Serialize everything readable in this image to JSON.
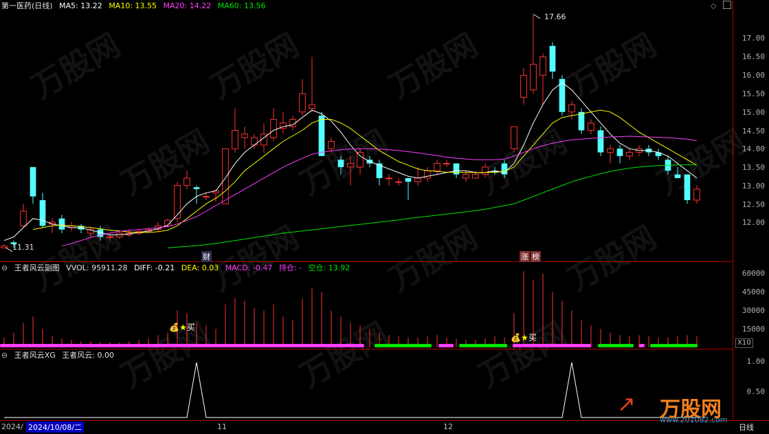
{
  "colors": {
    "up": "#ff3232",
    "down": "#54ffff",
    "ma5": "#ffffff",
    "ma10": "#ffff00",
    "ma20": "#ff3cff",
    "ma60": "#00e600",
    "grid": "#b00000",
    "text": "#c0c0c0"
  },
  "main": {
    "title": "第一医药(日线)",
    "ma5": "MA5: 13.22",
    "ma10": "MA10: 13.55",
    "ma20": "MA20: 14.22",
    "ma60": "MA60: 13.56",
    "high_label": "17.66",
    "low_label": "11.31",
    "axis": [
      "17.00",
      "16.50",
      "16.00",
      "15.50",
      "15.00",
      "14.50",
      "14.00",
      "13.50",
      "13.00",
      "12.50",
      "12.00"
    ],
    "tags": {
      "cai": "财",
      "zhangting": "涨",
      "bang": "榜"
    },
    "corner_icons": [
      "diamond-icon",
      "square-icon"
    ]
  },
  "sub1": {
    "name": "王者风云副图",
    "vol": "VVOL: 95911.28",
    "diff": "DIFF: -0.21",
    "dea": "DEA: 0.03",
    "macd": "MACD: -0.47",
    "hold": "持仓: -",
    "empty": "空仓: 13.92",
    "axis": [
      "60000",
      "45000",
      "30000",
      "15000"
    ],
    "scale": "X10",
    "buy1": "买",
    "buy2": "买",
    "segments": [
      {
        "state": "hold",
        "start": 0,
        "end": 530
      },
      {
        "state": "empty",
        "start": 545,
        "end": 628
      },
      {
        "state": "hold",
        "start": 638,
        "end": 660
      },
      {
        "state": "empty",
        "start": 668,
        "end": 738
      },
      {
        "state": "hold",
        "start": 746,
        "end": 860
      },
      {
        "state": "empty",
        "start": 870,
        "end": 922
      },
      {
        "state": "hold",
        "start": 930,
        "end": 938
      },
      {
        "state": "empty",
        "start": 946,
        "end": 1015
      }
    ]
  },
  "sub2": {
    "name": "王者风云XG",
    "val": "王者风云: 0.00",
    "axis": [
      "1.00",
      "0.50"
    ]
  },
  "xaxis": {
    "left": "2024/",
    "cursor": "2024/10/08/二",
    "m11": "11",
    "m12": "12",
    "period": "日线"
  },
  "watermark": {
    "brand": "万股网",
    "url": "www.201082.com"
  },
  "chart_data": {
    "type": "candlestick",
    "title": "第一医药(日线)",
    "price_range": [
      11.0,
      17.6
    ],
    "candles": [
      {
        "o": 11.3,
        "c": 11.35,
        "h": 11.4,
        "l": 11.31
      },
      {
        "o": 11.45,
        "c": 11.4,
        "h": 11.5,
        "l": 11.3
      },
      {
        "o": 11.9,
        "c": 12.3,
        "h": 12.5,
        "l": 11.85
      },
      {
        "o": 13.5,
        "c": 12.7,
        "h": 13.5,
        "l": 12.5
      },
      {
        "o": 12.6,
        "c": 11.9,
        "h": 12.8,
        "l": 11.85
      },
      {
        "o": 11.95,
        "c": 12.0,
        "h": 12.1,
        "l": 11.7
      },
      {
        "o": 12.1,
        "c": 11.8,
        "h": 12.2,
        "l": 11.7
      },
      {
        "o": 11.85,
        "c": 11.9,
        "h": 12.0,
        "l": 11.75
      },
      {
        "o": 11.9,
        "c": 11.8,
        "h": 11.95,
        "l": 11.7
      },
      {
        "o": 11.7,
        "c": 11.8,
        "h": 11.9,
        "l": 11.6
      },
      {
        "o": 11.8,
        "c": 11.6,
        "h": 11.9,
        "l": 11.5
      },
      {
        "o": 11.6,
        "c": 11.6,
        "h": 11.7,
        "l": 11.5
      },
      {
        "o": 11.6,
        "c": 11.7,
        "h": 11.75,
        "l": 11.55
      },
      {
        "o": 11.65,
        "c": 11.7,
        "h": 11.8,
        "l": 11.6
      },
      {
        "o": 11.7,
        "c": 11.75,
        "h": 11.8,
        "l": 11.65
      },
      {
        "o": 11.75,
        "c": 11.8,
        "h": 11.85,
        "l": 11.7
      },
      {
        "o": 11.8,
        "c": 11.9,
        "h": 12.0,
        "l": 11.75
      },
      {
        "o": 11.9,
        "c": 12.05,
        "h": 12.1,
        "l": 11.85
      },
      {
        "o": 12.1,
        "c": 13.0,
        "h": 13.1,
        "l": 12.0
      },
      {
        "o": 13.0,
        "c": 13.2,
        "h": 13.4,
        "l": 12.9
      },
      {
        "o": 12.95,
        "c": 12.9,
        "h": 13.0,
        "l": 12.5
      },
      {
        "o": 12.7,
        "c": 12.7,
        "h": 12.8,
        "l": 12.6
      },
      {
        "o": 12.8,
        "c": 12.85,
        "h": 12.9,
        "l": 12.55
      },
      {
        "o": 12.5,
        "c": 14.0,
        "h": 14.0,
        "l": 12.5
      },
      {
        "o": 14.0,
        "c": 14.5,
        "h": 15.1,
        "l": 13.9
      },
      {
        "o": 14.3,
        "c": 14.4,
        "h": 14.6,
        "l": 14.0
      },
      {
        "o": 14.1,
        "c": 14.3,
        "h": 14.4,
        "l": 14.0
      },
      {
        "o": 14.1,
        "c": 14.4,
        "h": 14.7,
        "l": 13.9
      },
      {
        "o": 14.3,
        "c": 14.8,
        "h": 15.1,
        "l": 14.2
      },
      {
        "o": 14.55,
        "c": 14.7,
        "h": 15.0,
        "l": 14.4
      },
      {
        "o": 14.6,
        "c": 14.8,
        "h": 14.9,
        "l": 14.5
      },
      {
        "o": 15.0,
        "c": 15.5,
        "h": 15.9,
        "l": 14.9
      },
      {
        "o": 15.1,
        "c": 15.2,
        "h": 16.5,
        "l": 15.0
      },
      {
        "o": 14.9,
        "c": 13.8,
        "h": 15.0,
        "l": 13.8
      },
      {
        "o": 14.0,
        "c": 14.2,
        "h": 14.3,
        "l": 13.9
      },
      {
        "o": 13.7,
        "c": 13.5,
        "h": 13.8,
        "l": 13.3
      },
      {
        "o": 13.5,
        "c": 13.6,
        "h": 13.8,
        "l": 13.0
      },
      {
        "o": 13.5,
        "c": 13.9,
        "h": 14.0,
        "l": 13.3
      },
      {
        "o": 13.7,
        "c": 13.6,
        "h": 13.8,
        "l": 13.5
      },
      {
        "o": 13.6,
        "c": 13.2,
        "h": 13.7,
        "l": 13.0
      },
      {
        "o": 13.2,
        "c": 13.2,
        "h": 13.3,
        "l": 13.0
      },
      {
        "o": 13.1,
        "c": 13.1,
        "h": 13.2,
        "l": 13.0
      },
      {
        "o": 13.2,
        "c": 13.1,
        "h": 13.2,
        "l": 12.6
      },
      {
        "o": 13.1,
        "c": 13.2,
        "h": 13.5,
        "l": 13.0
      },
      {
        "o": 13.2,
        "c": 13.4,
        "h": 13.5,
        "l": 13.1
      },
      {
        "o": 13.4,
        "c": 13.6,
        "h": 13.7,
        "l": 13.3
      },
      {
        "o": 13.6,
        "c": 13.6,
        "h": 13.7,
        "l": 13.5
      },
      {
        "o": 13.6,
        "c": 13.3,
        "h": 13.6,
        "l": 13.2
      },
      {
        "o": 13.2,
        "c": 13.3,
        "h": 13.4,
        "l": 13.1
      },
      {
        "o": 13.2,
        "c": 13.3,
        "h": 13.4,
        "l": 13.2
      },
      {
        "o": 13.3,
        "c": 13.5,
        "h": 13.6,
        "l": 13.2
      },
      {
        "o": 13.4,
        "c": 13.35,
        "h": 13.5,
        "l": 13.3
      },
      {
        "o": 13.6,
        "c": 13.3,
        "h": 13.7,
        "l": 13.2
      },
      {
        "o": 14.0,
        "c": 14.6,
        "h": 14.6,
        "l": 13.9
      },
      {
        "o": 15.4,
        "c": 16.0,
        "h": 16.2,
        "l": 15.2
      },
      {
        "o": 15.6,
        "c": 16.3,
        "h": 17.66,
        "l": 15.5
      },
      {
        "o": 16.0,
        "c": 16.5,
        "h": 16.6,
        "l": 15.2
      },
      {
        "o": 16.8,
        "c": 16.1,
        "h": 16.9,
        "l": 15.9
      },
      {
        "o": 15.9,
        "c": 15.0,
        "h": 16.0,
        "l": 14.9
      },
      {
        "o": 15.0,
        "c": 15.2,
        "h": 15.3,
        "l": 14.8
      },
      {
        "o": 15.0,
        "c": 14.5,
        "h": 15.1,
        "l": 14.4
      },
      {
        "o": 14.5,
        "c": 14.7,
        "h": 14.8,
        "l": 14.4
      },
      {
        "o": 14.5,
        "c": 13.9,
        "h": 14.6,
        "l": 13.8
      },
      {
        "o": 13.9,
        "c": 14.0,
        "h": 14.1,
        "l": 13.6
      },
      {
        "o": 14.0,
        "c": 13.8,
        "h": 14.1,
        "l": 13.6
      },
      {
        "o": 13.8,
        "c": 13.9,
        "h": 14.0,
        "l": 13.7
      },
      {
        "o": 13.9,
        "c": 14.0,
        "h": 14.1,
        "l": 13.8
      },
      {
        "o": 14.0,
        "c": 13.9,
        "h": 14.1,
        "l": 13.8
      },
      {
        "o": 13.9,
        "c": 13.8,
        "h": 14.0,
        "l": 13.7
      },
      {
        "o": 13.7,
        "c": 13.4,
        "h": 13.8,
        "l": 13.3
      },
      {
        "o": 13.3,
        "c": 13.2,
        "h": 13.5,
        "l": 13.2
      },
      {
        "o": 13.3,
        "c": 12.6,
        "h": 13.3,
        "l": 12.5
      },
      {
        "o": 12.6,
        "c": 12.9,
        "h": 13.0,
        "l": 12.5
      }
    ],
    "ma5": [
      11.5,
      11.6,
      11.85,
      12.1,
      12.05,
      11.95,
      11.9,
      11.85,
      11.85,
      11.78,
      11.72,
      11.65,
      11.66,
      11.68,
      11.72,
      11.76,
      11.82,
      11.92,
      12.2,
      12.5,
      12.7,
      12.8,
      12.85,
      13.2,
      13.6,
      13.9,
      14.1,
      14.3,
      14.5,
      14.6,
      14.65,
      14.85,
      15.05,
      14.95,
      14.75,
      14.45,
      14.1,
      13.8,
      13.65,
      13.55,
      13.45,
      13.35,
      13.25,
      13.2,
      13.25,
      13.3,
      13.35,
      13.4,
      13.4,
      13.35,
      13.35,
      13.4,
      13.35,
      13.6,
      14.1,
      14.7,
      15.2,
      15.6,
      15.8,
      15.6,
      15.3,
      15.0,
      14.7,
      14.4,
      14.15,
      14.0,
      13.95,
      13.95,
      13.9,
      13.8,
      13.6,
      13.4,
      13.2
    ],
    "ma10": [
      null,
      null,
      null,
      11.8,
      11.85,
      11.9,
      11.92,
      11.9,
      11.88,
      11.85,
      11.82,
      11.78,
      11.76,
      11.73,
      11.72,
      11.72,
      11.74,
      11.78,
      11.9,
      12.1,
      12.3,
      12.5,
      12.65,
      12.85,
      13.1,
      13.4,
      13.6,
      13.8,
      14.0,
      14.2,
      14.35,
      14.5,
      14.7,
      14.8,
      14.8,
      14.7,
      14.55,
      14.35,
      14.15,
      13.95,
      13.8,
      13.65,
      13.55,
      13.45,
      13.4,
      13.38,
      13.36,
      13.36,
      13.35,
      13.35,
      13.35,
      13.36,
      13.38,
      13.5,
      13.8,
      14.1,
      14.4,
      14.7,
      14.85,
      14.9,
      14.95,
      15.0,
      15.05,
      15.0,
      14.85,
      14.65,
      14.45,
      14.3,
      14.15,
      14.0,
      13.85,
      13.7,
      13.55
    ],
    "ma20": [
      null,
      null,
      null,
      null,
      null,
      null,
      11.35,
      11.42,
      11.5,
      11.58,
      11.65,
      11.7,
      11.75,
      11.78,
      11.8,
      11.82,
      11.85,
      11.88,
      11.95,
      12.05,
      12.15,
      12.3,
      12.45,
      12.6,
      12.75,
      12.9,
      13.05,
      13.2,
      13.35,
      13.5,
      13.62,
      13.74,
      13.85,
      13.9,
      13.94,
      13.97,
      13.99,
      14.0,
      14.0,
      13.99,
      13.97,
      13.95,
      13.92,
      13.89,
      13.85,
      13.81,
      13.77,
      13.74,
      13.72,
      13.7,
      13.7,
      13.7,
      13.72,
      13.8,
      13.9,
      14.0,
      14.08,
      14.15,
      14.2,
      14.24,
      14.26,
      14.28,
      14.3,
      14.32,
      14.33,
      14.34,
      14.33,
      14.32,
      14.31,
      14.3,
      14.28,
      14.26,
      14.22
    ],
    "ma60": [
      null,
      null,
      null,
      null,
      null,
      null,
      null,
      null,
      null,
      null,
      null,
      null,
      null,
      null,
      null,
      null,
      null,
      11.3,
      11.32,
      11.34,
      11.36,
      11.39,
      11.42,
      11.46,
      11.5,
      11.54,
      11.58,
      11.62,
      11.66,
      11.7,
      11.73,
      11.76,
      11.79,
      11.82,
      11.85,
      11.88,
      11.91,
      11.94,
      11.97,
      12.0,
      12.03,
      12.06,
      12.1,
      12.13,
      12.16,
      12.19,
      12.22,
      12.25,
      12.28,
      12.31,
      12.35,
      12.4,
      12.45,
      12.5,
      12.6,
      12.7,
      12.8,
      12.9,
      13.0,
      13.1,
      13.18,
      13.25,
      13.32,
      13.38,
      13.43,
      13.47,
      13.5,
      13.52,
      13.54,
      13.55,
      13.56,
      13.56,
      13.56
    ],
    "volume": [
      8000,
      12000,
      20000,
      25000,
      15000,
      9000,
      7000,
      6000,
      5000,
      5000,
      4000,
      4000,
      4000,
      5000,
      6000,
      7000,
      10000,
      12000,
      30000,
      28000,
      20000,
      18000,
      15000,
      35000,
      40000,
      38000,
      32000,
      30000,
      35000,
      25000,
      22000,
      40000,
      48000,
      45000,
      30000,
      25000,
      20000,
      18000,
      15000,
      12000,
      10000,
      9000,
      8000,
      8000,
      9000,
      10000,
      8000,
      7000,
      6000,
      6000,
      7000,
      9000,
      8000,
      28000,
      62000,
      55000,
      60000,
      45000,
      38000,
      30000,
      22000,
      18000,
      15000,
      12000,
      10000,
      9000,
      10000,
      9000,
      8000,
      8000,
      9000,
      10000,
      9000
    ],
    "xg_signal": [
      0,
      0,
      0,
      0,
      0,
      0,
      0,
      0,
      0,
      0,
      0,
      0,
      0,
      0,
      0,
      0,
      0,
      0,
      0,
      0,
      1,
      0,
      0,
      0,
      0,
      0,
      0,
      0,
      0,
      0,
      0,
      0,
      0,
      0,
      0,
      0,
      0,
      0,
      0,
      0,
      0,
      0,
      0,
      0,
      0,
      0,
      0,
      0,
      0,
      0,
      0,
      0,
      0,
      0,
      0,
      0,
      0,
      0,
      0,
      1,
      0,
      0,
      0,
      0,
      0,
      0,
      0,
      0,
      0,
      0,
      0,
      0,
      0
    ]
  }
}
